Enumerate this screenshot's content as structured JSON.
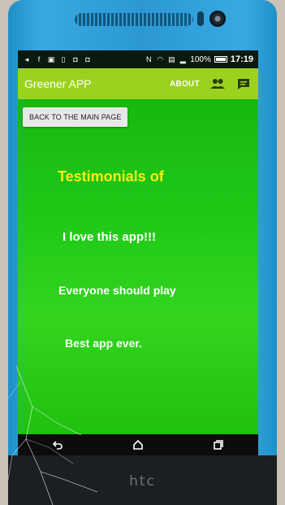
{
  "status_bar": {
    "battery": "100%",
    "time": "17:19"
  },
  "app_bar": {
    "title": "Greener APP",
    "about": "ABOUT",
    "icons": [
      "people-icon",
      "chat-icon"
    ]
  },
  "page": {
    "back_button": "BACK TO THE MAIN PAGE",
    "heading": "Testimonials of",
    "testimonials": [
      "I love this app!!!",
      "Everyone should play",
      "Best app ever."
    ]
  },
  "nav_bar": {
    "icons": [
      "back-icon",
      "home-icon",
      "recents-icon"
    ]
  },
  "device": {
    "brand": "htc"
  },
  "colors": {
    "app_bar": "#9bd11f",
    "content_green": "#1fc817",
    "heading_yellow": "#f6ee14",
    "phone_blue": "#2b98d3"
  }
}
